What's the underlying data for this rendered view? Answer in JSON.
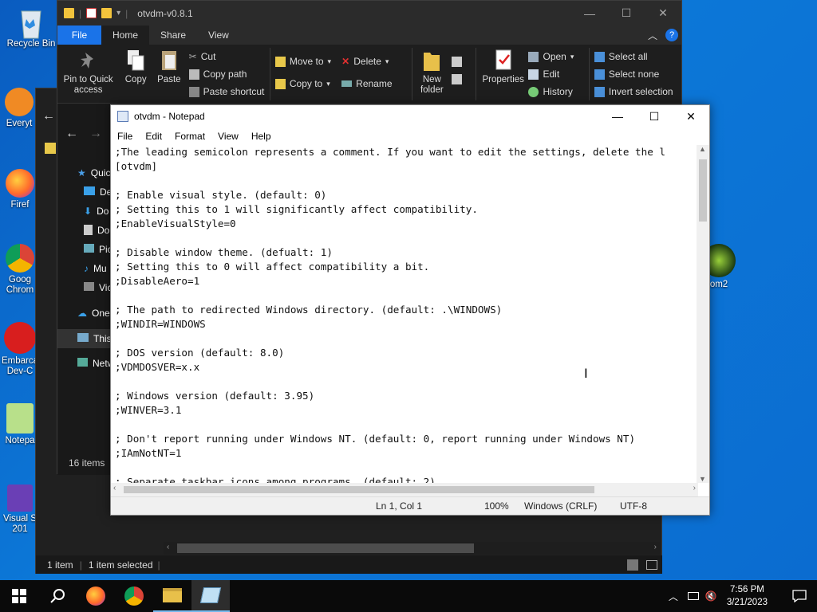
{
  "desktop_icons": [
    {
      "label": "Recycle Bin",
      "icon": "recycle-bin-icon"
    },
    {
      "label": "Everyt",
      "icon": "everything-icon"
    },
    {
      "label": "Firef",
      "icon": "firefox-icon"
    },
    {
      "label": "Goog\nChrom",
      "icon": "chrome-icon"
    },
    {
      "label": "Embarca\nDev-C",
      "icon": "devcpp-icon"
    },
    {
      "label": "Notepa",
      "icon": "notepadpp-icon"
    },
    {
      "label": "Visual S\n201",
      "icon": "visual-studio-icon"
    },
    {
      "label": "om2",
      "icon": "app-icon"
    }
  ],
  "explorer": {
    "title": "otvdm-v0.8.1",
    "tabs": [
      "File",
      "Home",
      "Share",
      "View"
    ],
    "ribbon": {
      "pin": "Pin to Quick\naccess",
      "copy": "Copy",
      "paste": "Paste",
      "cut": "Cut",
      "copy_path": "Copy path",
      "paste_shortcut": "Paste shortcut",
      "move_to": "Move to",
      "copy_to": "Copy to",
      "delete": "Delete",
      "rename": "Rename",
      "new_folder": "New\nfolder",
      "properties": "Properties",
      "open": "Open",
      "edit": "Edit",
      "history": "History",
      "select_all": "Select all",
      "select_none": "Select none",
      "invert_selection": "Invert selection"
    },
    "nav_items": [
      "Quic",
      "De",
      "Do",
      "Do",
      "Pic",
      "Mu",
      "Vic",
      "One",
      "This",
      "Netw"
    ],
    "items_count": "16 items",
    "status_left": "1 item",
    "status_selected": "1 item selected"
  },
  "notepad": {
    "title": "otvdm - Notepad",
    "menu": [
      "File",
      "Edit",
      "Format",
      "View",
      "Help"
    ],
    "lines": [
      ";The leading semicolon represents a comment. If you want to edit the settings, delete the l",
      "[otvdm]",
      "",
      "; Enable visual style. (default: 0)",
      "; Setting this to 1 will significantly affect compatibility.",
      ";EnableVisualStyle=0",
      "",
      "; Disable window theme. (defualt: 1)",
      "; Setting this to 0 will affect compatibility a bit.",
      ";DisableAero=1",
      "",
      "; The path to redirected Windows directory. (default: .\\WINDOWS)",
      ";WINDIR=WINDOWS",
      "",
      "; DOS version (default: 8.0)",
      ";VDMDOSVER=x.x",
      "",
      "; Windows version (default: 3.95)",
      ";WINVER=3.1",
      "",
      "; Don't report running under Windows NT. (default: 0, report running under Windows NT)",
      ";IAmNotNT=1",
      "",
      "; Separate taskbar icons among programs. (default: 2)"
    ],
    "status": {
      "position": "Ln 1, Col 1",
      "zoom": "100%",
      "line_ending": "Windows (CRLF)",
      "encoding": "UTF-8"
    }
  },
  "taskbar": {
    "time": "7:56 PM",
    "date": "3/21/2023",
    "apps": [
      "start-icon",
      "search-icon",
      "firefox-icon",
      "chrome-icon",
      "file-explorer-icon",
      "notepad-icon"
    ]
  },
  "colors": {
    "accent": "#1a73e8",
    "desktop": "#0c78d8",
    "taskbar": "#0a0a0a"
  }
}
